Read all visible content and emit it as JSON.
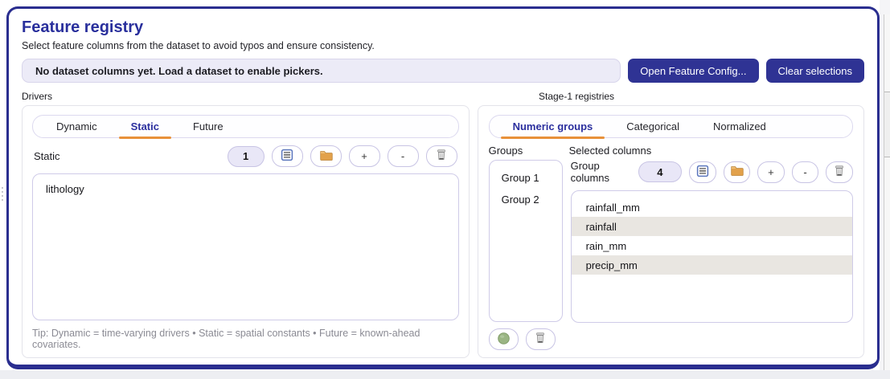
{
  "header": {
    "title": "Feature registry",
    "subtitle": "Select feature columns from the dataset to avoid typos and ensure consistency.",
    "status_message": "No dataset columns yet. Load a dataset to enable pickers.",
    "open_config_label": "Open Feature Config...",
    "clear_label": "Clear selections"
  },
  "glyphs": {
    "plus": "+",
    "minus": "-"
  },
  "drivers": {
    "caption": "Drivers",
    "tabs": [
      {
        "label": "Dynamic"
      },
      {
        "label": "Static"
      },
      {
        "label": "Future"
      }
    ],
    "active_tab": "Static",
    "section_label": "Static",
    "count": "1",
    "items": [
      "lithology"
    ],
    "tip": "Tip: Dynamic = time-varying drivers • Static = spatial constants • Future = known-ahead covariates."
  },
  "registries": {
    "caption": "Stage-1 registries",
    "tabs": [
      {
        "label": "Numeric groups"
      },
      {
        "label": "Categorical"
      },
      {
        "label": "Normalized"
      }
    ],
    "active_tab": "Numeric groups",
    "groups_label": "Groups",
    "selected_label": "Selected columns",
    "groups": [
      "Group 1",
      "Group 2"
    ],
    "group_columns_label": "Group columns",
    "count": "4",
    "columns": [
      "rainfall_mm",
      "rainfall",
      "rain_mm",
      "precip_mm"
    ]
  },
  "colors": {
    "accent_navy": "#2f3394",
    "window_border": "#2a2e8f",
    "tab_active_text": "#2b2f9e",
    "tab_underline": "#e8913a",
    "status_bg": "#ecebf7",
    "row_stripe": "#e9e6e1",
    "badge_bg": "#e9e7f7"
  }
}
